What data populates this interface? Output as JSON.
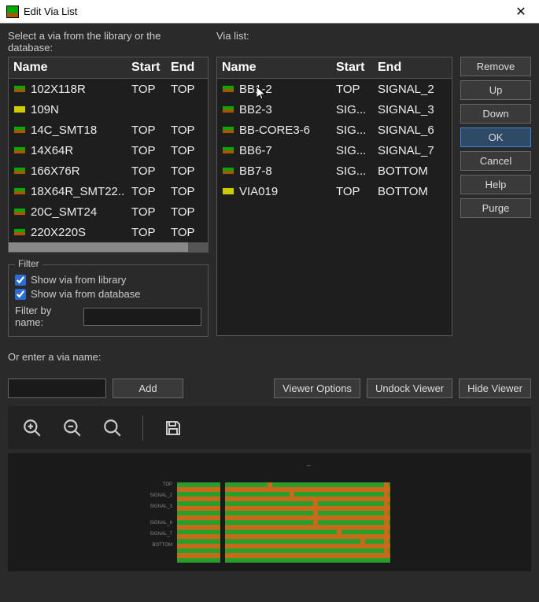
{
  "window": {
    "title": "Edit Via List"
  },
  "labels": {
    "select_lib": "Select a via from the library or the database:",
    "via_list": "Via list:",
    "filter": "Filter",
    "show_lib": "Show via from library",
    "show_db": "Show via from database",
    "filter_by_name": "Filter by name:",
    "enter_via": "Or enter a via name:"
  },
  "columns": {
    "name": "Name",
    "start": "Start",
    "end": "End"
  },
  "library": [
    {
      "icon": "lib",
      "name": "102X118R",
      "start": "TOP",
      "end": "TOP"
    },
    {
      "icon": "yellow",
      "name": "109N",
      "start": "",
      "end": ""
    },
    {
      "icon": "lib",
      "name": "14C_SMT18",
      "start": "TOP",
      "end": "TOP"
    },
    {
      "icon": "lib",
      "name": "14X64R",
      "start": "TOP",
      "end": "TOP"
    },
    {
      "icon": "lib",
      "name": "166X76R",
      "start": "TOP",
      "end": "TOP"
    },
    {
      "icon": "lib",
      "name": "18X64R_SMT22..",
      "start": "TOP",
      "end": "TOP"
    },
    {
      "icon": "lib",
      "name": "20C_SMT24",
      "start": "TOP",
      "end": "TOP"
    },
    {
      "icon": "lib",
      "name": "220X220S",
      "start": "TOP",
      "end": "TOP"
    }
  ],
  "vialist": [
    {
      "icon": "lib",
      "name": "BB1-2",
      "start": "TOP",
      "end": "SIGNAL_2"
    },
    {
      "icon": "lib",
      "name": "BB2-3",
      "start": "SIG...",
      "end": "SIGNAL_3"
    },
    {
      "icon": "lib",
      "name": "BB-CORE3-6",
      "start": "SIG...",
      "end": "SIGNAL_6"
    },
    {
      "icon": "lib",
      "name": "BB6-7",
      "start": "SIG...",
      "end": "SIGNAL_7"
    },
    {
      "icon": "lib",
      "name": "BB7-8",
      "start": "SIG...",
      "end": "BOTTOM"
    },
    {
      "icon": "yellow",
      "name": "VIA019",
      "start": "TOP",
      "end": "BOTTOM"
    }
  ],
  "buttons": {
    "remove": "Remove",
    "up": "Up",
    "down": "Down",
    "ok": "OK",
    "cancel": "Cancel",
    "help": "Help",
    "purge": "Purge",
    "add": "Add",
    "viewer_options": "Viewer Options",
    "undock_viewer": "Undock Viewer",
    "hide_viewer": "Hide Viewer"
  },
  "filter": {
    "show_lib": true,
    "show_db": true,
    "name_value": ""
  },
  "enter_name_value": ""
}
